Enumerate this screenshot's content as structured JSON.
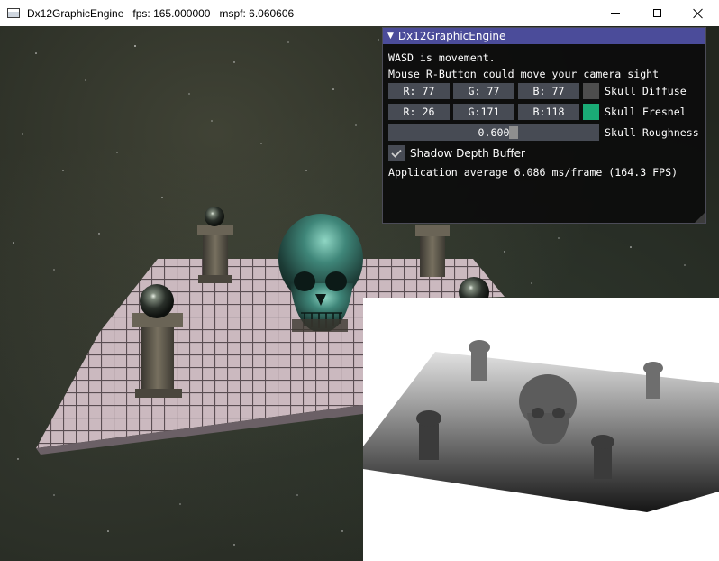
{
  "window": {
    "title": "Dx12GraphicEngine   fps: 165.000000   mspf: 6.060606",
    "app_icon": "app-window-icon",
    "controls": [
      "minimize-icon",
      "maximize-icon",
      "close-icon"
    ]
  },
  "imgui": {
    "title": "Dx12GraphicEngine",
    "line1": "WASD is movement.",
    "line2": "Mouse R-Button could move your camera sight",
    "diffuse": {
      "r": "R: 77",
      "g": "G: 77",
      "b": "B: 77",
      "label": "Skull Diffuse",
      "color": "#4d4d4d"
    },
    "fresnel": {
      "r": "R: 26",
      "g": "G:171",
      "b": "B:118",
      "label": "Skull Fresnel",
      "color": "#1aab76"
    },
    "roughness": {
      "value": "0.600",
      "label": "Skull Roughness",
      "fraction": 0.6
    },
    "shadow_checkbox": {
      "label": "Shadow Depth Buffer",
      "checked": true
    },
    "stats": "Application average 6.086 ms/frame (164.3 FPS)",
    "accent_title": "#4b4c9a"
  }
}
